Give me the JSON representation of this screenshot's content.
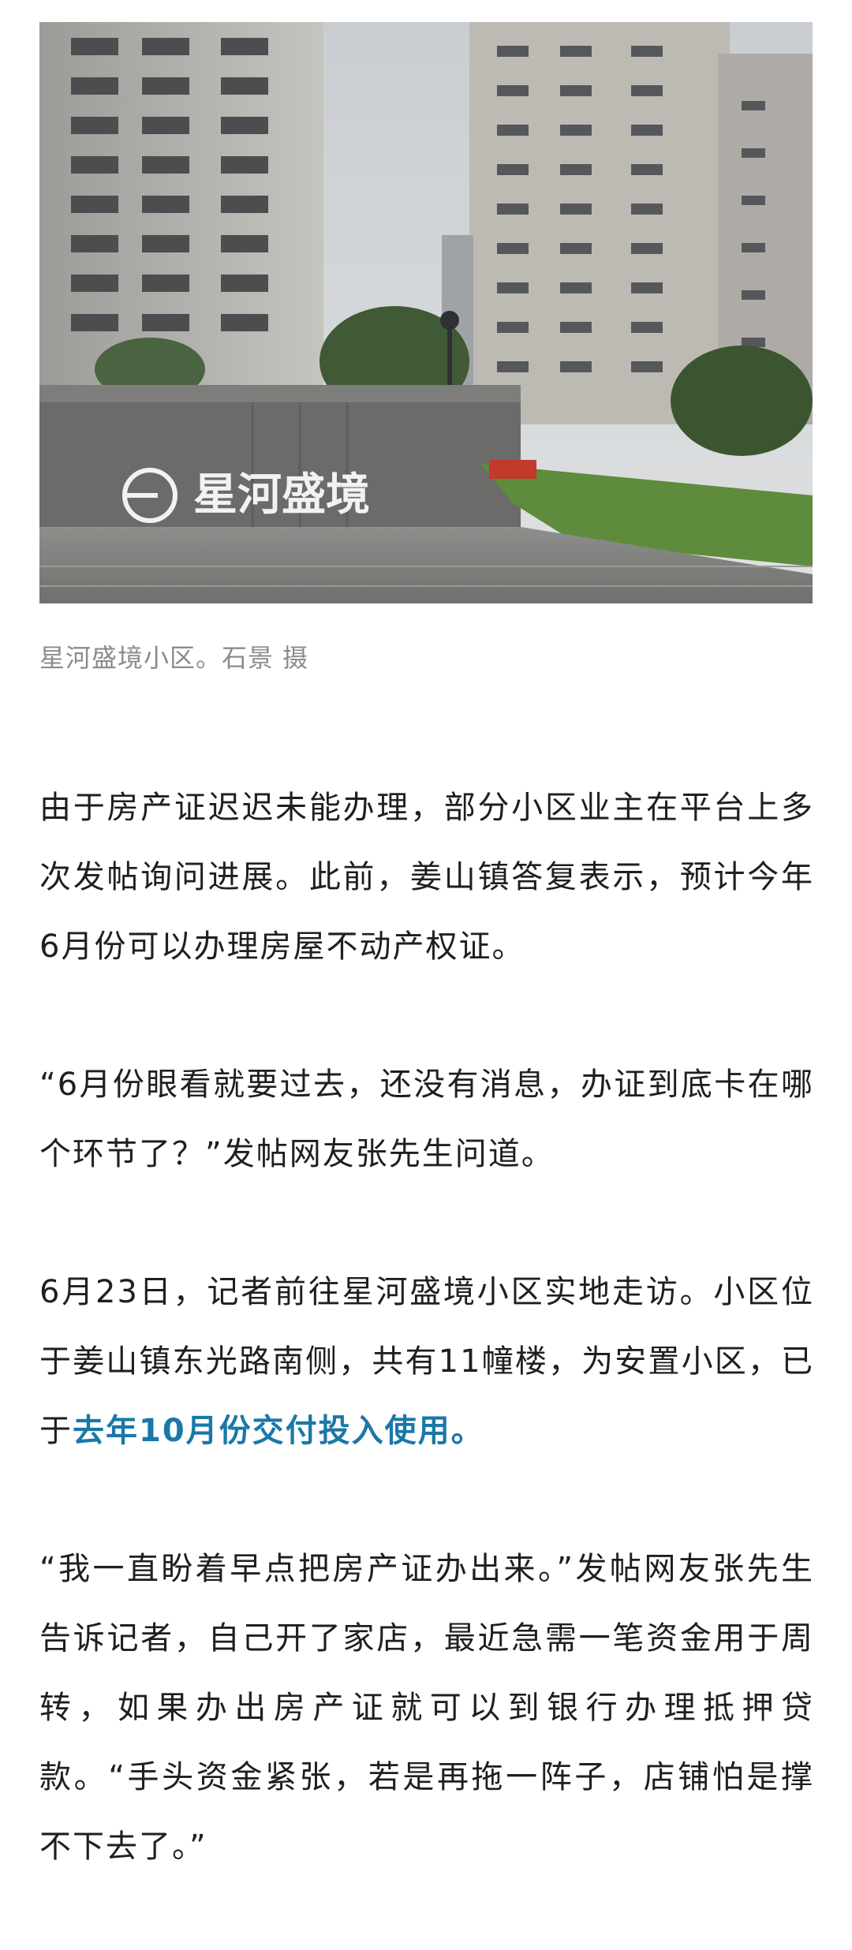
{
  "photo": {
    "sign_text": "星河盛境",
    "description_icon": "photo"
  },
  "caption": "星河盛境小区。石景 摄",
  "paragraphs": [
    {
      "text": "由于房产证迟迟未能办理，部分小区业主在平台上多次发帖询问进展。此前，姜山镇答复表示，预计今年6月份可以办理房屋不动产权证。"
    },
    {
      "text": "“6月份眼看就要过去，还没有消息，办证到底卡在哪个环节了？”发帖网友张先生问道。"
    },
    {
      "text": "6月23日，记者前往星河盛境小区实地走访。小区位于姜山镇东光路南侧，共有11幢楼，为安置小区，已于",
      "highlight": "去年10月份交付投入使用。"
    },
    {
      "text": "“我一直盼着早点把房产证办出来。”发帖网友张先生告诉记者，自己开了家店，最近急需一笔资金用于周转，如果办出房产证就可以到银行办理抵押贷款。“手头资金紧张，若是再拖一阵子，店铺怕是撑不下去了。”"
    }
  ],
  "colors": {
    "link": "#1a78a8",
    "caption": "#8c8c8c",
    "text": "#1f1f1f"
  }
}
